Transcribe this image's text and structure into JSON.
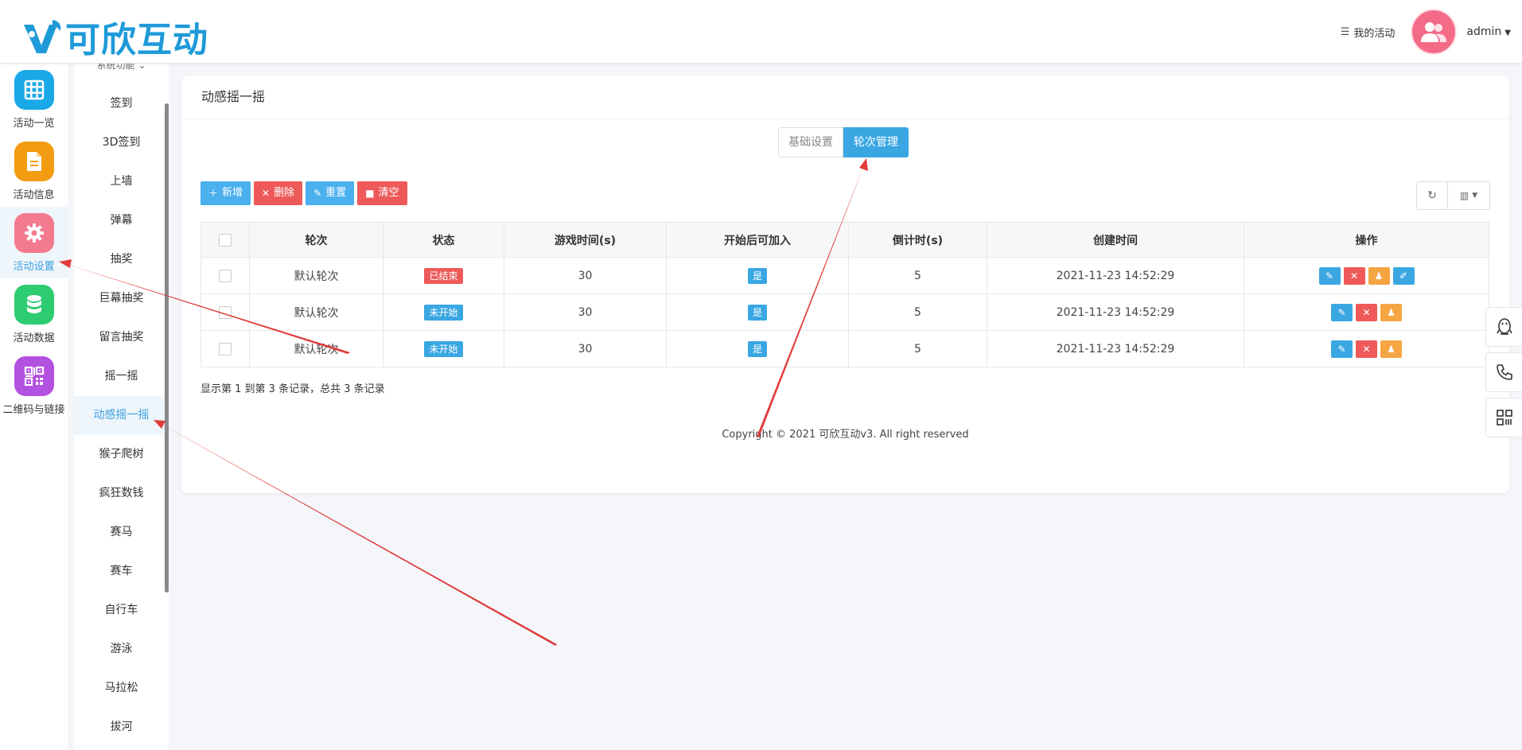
{
  "brand": {
    "name": "可欣互动"
  },
  "header": {
    "my_activity": "我的活动",
    "user": "admin"
  },
  "iconbar": [
    {
      "label": "活动一览",
      "icon": "grid-icon",
      "color": "#1aa9e8"
    },
    {
      "label": "活动信息",
      "icon": "document-icon",
      "color": "#f39c12"
    },
    {
      "label": "活动设置",
      "icon": "gear-icon",
      "color": "#f47a8f"
    },
    {
      "label": "活动数据",
      "icon": "database-icon",
      "color": "#2ecc71"
    },
    {
      "label": "二维码与链接",
      "icon": "qrcode-icon",
      "color": "#b351e0"
    }
  ],
  "submenu": {
    "header": "系统功能",
    "items": [
      "签到",
      "3D签到",
      "上墙",
      "弹幕",
      "抽奖",
      "巨幕抽奖",
      "留言抽奖",
      "摇一摇",
      "动感摇一摇",
      "猴子爬树",
      "疯狂数钱",
      "赛马",
      "赛车",
      "自行车",
      "游泳",
      "马拉松",
      "拔河"
    ],
    "active_index": 8
  },
  "card": {
    "title": "动感摇一摇"
  },
  "tabs": [
    "基础设置",
    "轮次管理"
  ],
  "toolbar": {
    "add": "新增",
    "delete": "删除",
    "reset": "重置",
    "clear": "清空"
  },
  "table": {
    "headers": [
      "轮次",
      "状态",
      "游戏时间(s)",
      "开始后可加入",
      "倒计时(s)",
      "创建时间",
      "操作"
    ],
    "rows": [
      {
        "name": "默认轮次",
        "status": "已结束",
        "status_color": "#ee5a5a",
        "time": "30",
        "join": "是",
        "countdown": "5",
        "created": "2021-11-23 14:52:29"
      },
      {
        "name": "默认轮次",
        "status": "未开始",
        "status_color": "#3aa7e3",
        "time": "30",
        "join": "是",
        "countdown": "5",
        "created": "2021-11-23 14:52:29"
      },
      {
        "name": "默认轮次",
        "status": "未开始",
        "status_color": "#3aa7e3",
        "time": "30",
        "join": "是",
        "countdown": "5",
        "created": "2021-11-23 14:52:29"
      }
    ]
  },
  "pagination": {
    "summary": "显示第 1 到第 3 条记录，总共 3 条记录"
  },
  "footer": {
    "copyright": "Copyright © 2021 可欣互动v3. All right reserved"
  }
}
